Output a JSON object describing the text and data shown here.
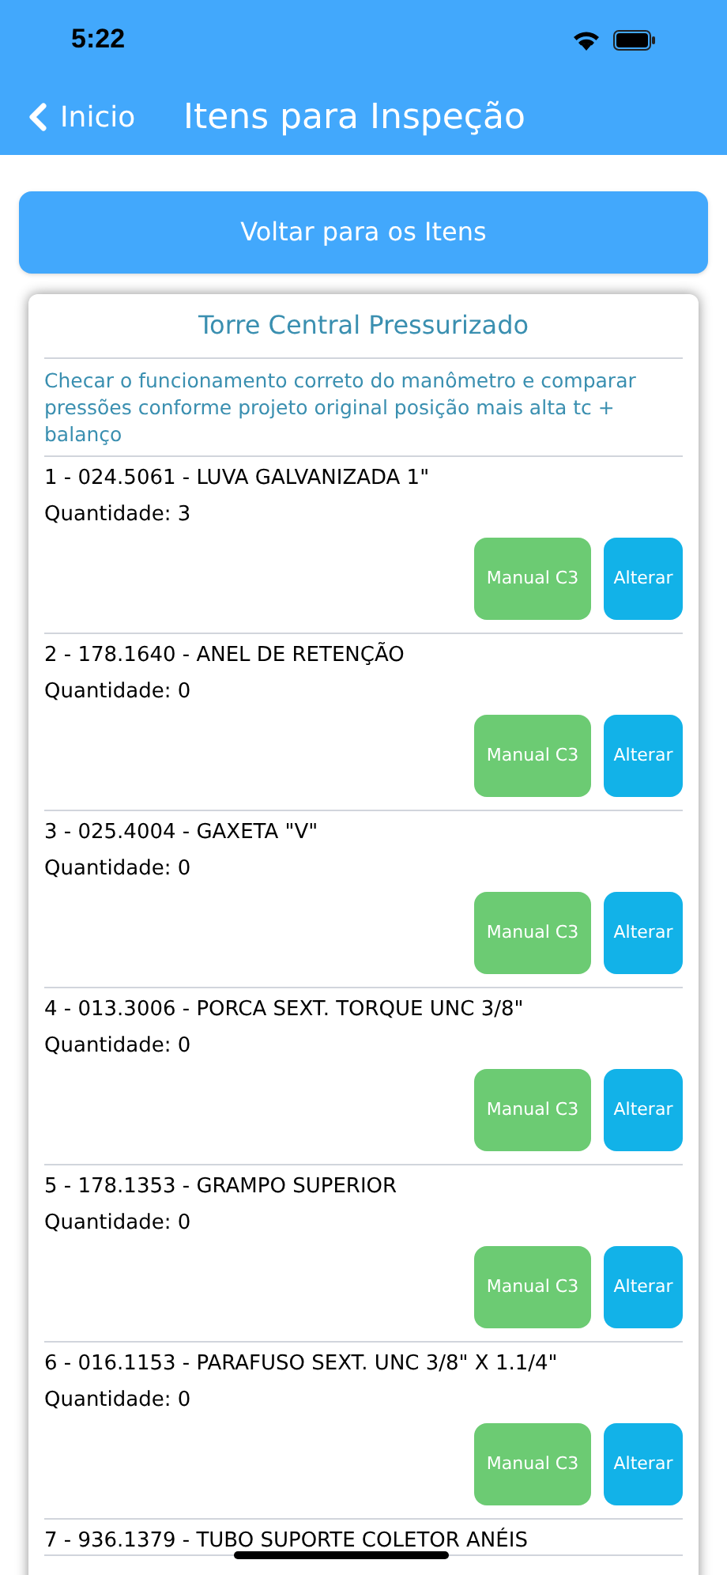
{
  "status_bar": {
    "time": "5:22"
  },
  "nav": {
    "back_label": "Inicio",
    "title": "Itens para Inspeção"
  },
  "back_button": "Voltar para os Itens",
  "card": {
    "title": "Torre Central Pressurizado",
    "description": "Checar o funcionamento correto do manômetro e comparar pressões conforme projeto original posição mais alta tc + balanço",
    "items": [
      {
        "name": "1 - 024.5061 - LUVA GALVANIZADA 1\"",
        "quantity": "Quantidade: 3",
        "manual": "Manual C3",
        "edit": "Alterar"
      },
      {
        "name": "2 - 178.1640 - ANEL DE RETENÇÃO",
        "quantity": "Quantidade: 0",
        "manual": "Manual C3",
        "edit": "Alterar"
      },
      {
        "name": "3 - 025.4004 - GAXETA \"V\"",
        "quantity": "Quantidade: 0",
        "manual": "Manual C3",
        "edit": "Alterar"
      },
      {
        "name": "4 - 013.3006 - PORCA SEXT. TORQUE UNC 3/8\"",
        "quantity": "Quantidade: 0",
        "manual": "Manual C3",
        "edit": "Alterar"
      },
      {
        "name": "5 - 178.1353 - GRAMPO SUPERIOR",
        "quantity": "Quantidade: 0",
        "manual": "Manual C3",
        "edit": "Alterar"
      },
      {
        "name": "6 - 016.1153 - PARAFUSO SEXT. UNC 3/8\" X 1.1/4\"",
        "quantity": "Quantidade: 0",
        "manual": "Manual C3",
        "edit": "Alterar"
      },
      {
        "name": "7 - 936.1379 - TUBO SUPORTE COLETOR ANÉIS"
      }
    ]
  }
}
